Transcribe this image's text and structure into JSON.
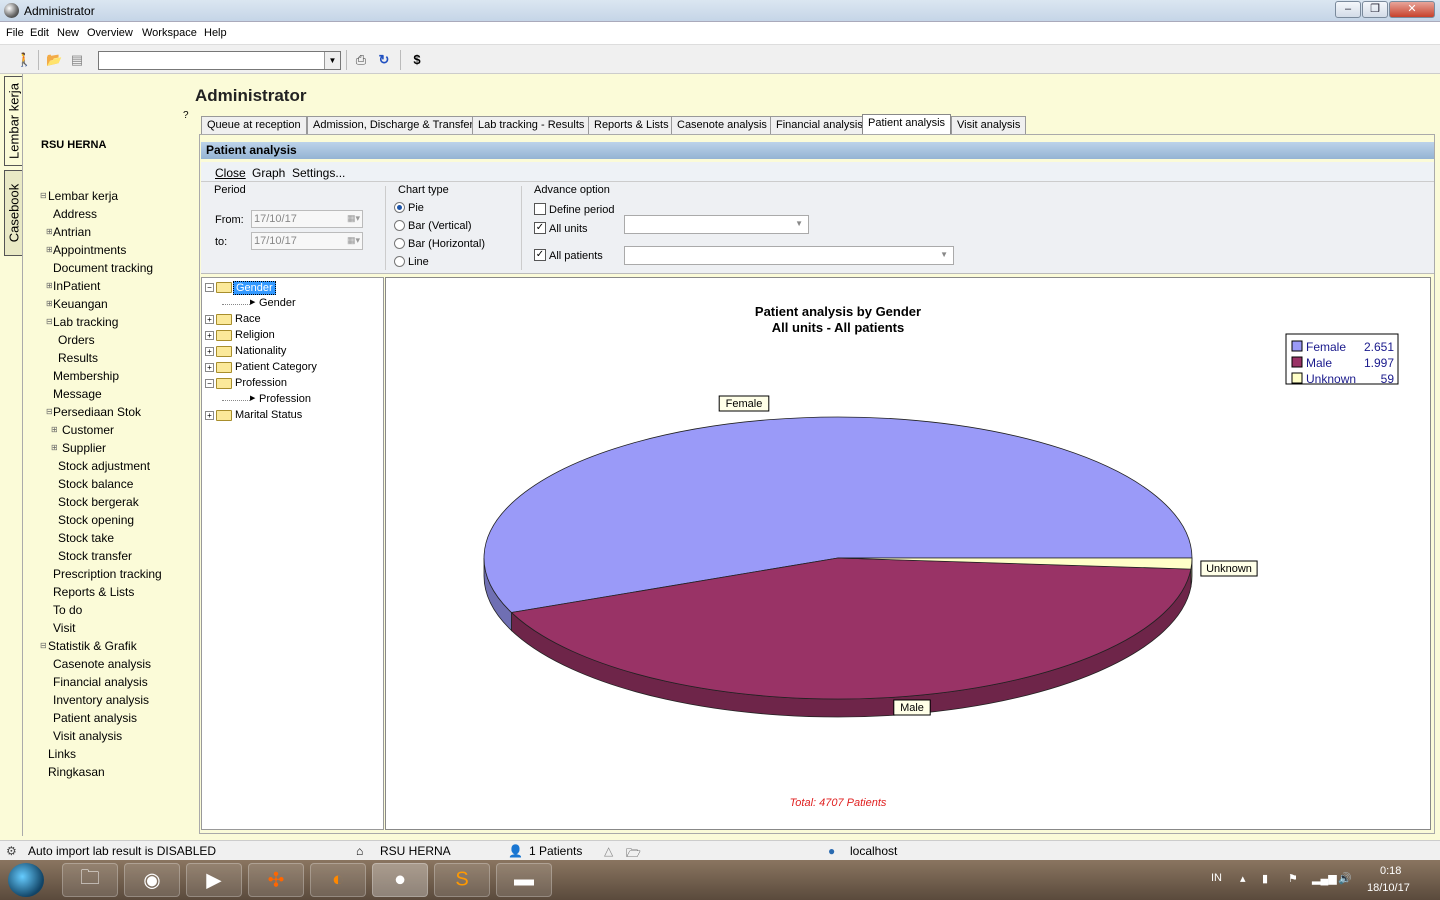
{
  "window": {
    "title": "Administrator"
  },
  "menu": [
    "File",
    "Edit",
    "New",
    "Overview",
    "Workspace",
    "Help"
  ],
  "vtabs": [
    "Lembar kerja",
    "Casebook"
  ],
  "header": {
    "title": "Administrator",
    "help": "?",
    "org": "RSU HERNA"
  },
  "nav": [
    {
      "label": "Lembar kerja",
      "ex": "⊟"
    },
    {
      "label": "Address"
    },
    {
      "label": "Antrian",
      "ex": "⊞"
    },
    {
      "label": "Appointments",
      "ex": "⊞"
    },
    {
      "label": "Document tracking"
    },
    {
      "label": "InPatient",
      "ex": "⊞"
    },
    {
      "label": "Keuangan",
      "ex": "⊞"
    },
    {
      "label": "Lab tracking",
      "ex": "⊟"
    },
    {
      "label": "Orders"
    },
    {
      "label": "Results"
    },
    {
      "label": "Membership"
    },
    {
      "label": "Message"
    },
    {
      "label": "Persediaan Stok",
      "ex": "⊟"
    },
    {
      "label": "Customer",
      "ex": "⊞"
    },
    {
      "label": "Supplier",
      "ex": "⊞"
    },
    {
      "label": "Stock adjustment"
    },
    {
      "label": "Stock balance"
    },
    {
      "label": "Stock bergerak"
    },
    {
      "label": "Stock opening"
    },
    {
      "label": "Stock take"
    },
    {
      "label": "Stock transfer"
    },
    {
      "label": "Prescription tracking"
    },
    {
      "label": "Reports & Lists"
    },
    {
      "label": "To do"
    },
    {
      "label": "Visit"
    },
    {
      "label": "Statistik & Grafik",
      "ex": "⊟"
    },
    {
      "label": "Casenote analysis"
    },
    {
      "label": "Financial analysis"
    },
    {
      "label": "Inventory analysis"
    },
    {
      "label": "Patient analysis"
    },
    {
      "label": "Visit analysis"
    },
    {
      "label": "Links"
    },
    {
      "label": "Ringkasan"
    }
  ],
  "tabs": [
    "Queue at reception",
    "Admission, Discharge & Transfer",
    "Lab tracking - Results",
    "Reports & Lists",
    "Casenote analysis",
    "Financial analysis",
    "Patient analysis",
    "Visit analysis"
  ],
  "active_tab": "Patient analysis",
  "panel": {
    "title": "Patient analysis",
    "actions": [
      "Close",
      "Graph",
      "Settings..."
    ],
    "period": {
      "label": "Period",
      "from_label": "From:",
      "to_label": "to:",
      "from": "17/10/17",
      "to": "17/10/17"
    },
    "chart_type": {
      "label": "Chart type",
      "options": [
        "Pie",
        "Bar (Vertical)",
        "Bar (Horizontal)",
        "Line"
      ],
      "selected": "Pie"
    },
    "advance": {
      "label": "Advance option",
      "define_period": "Define period",
      "all_units": "All units",
      "all_patients": "All patients"
    }
  },
  "tree": [
    {
      "label": "Gender",
      "expanded": true,
      "selected": true,
      "children": [
        "Gender"
      ]
    },
    {
      "label": "Race"
    },
    {
      "label": "Religion"
    },
    {
      "label": "Nationality"
    },
    {
      "label": "Patient Category"
    },
    {
      "label": "Profession",
      "expanded": true,
      "children": [
        "Profession"
      ]
    },
    {
      "label": "Marital Status"
    }
  ],
  "chart_data": {
    "type": "pie",
    "title": "Patient analysis by Gender",
    "subtitle": "All units - All patients",
    "slices": [
      {
        "name": "Female",
        "value": 2651,
        "display": "2.651",
        "color": "#9a9af8"
      },
      {
        "name": "Male",
        "value": 1997,
        "display": "1.997",
        "color": "#993366"
      },
      {
        "name": "Unknown",
        "value": 59,
        "display": "59",
        "color": "#ffffc8"
      }
    ],
    "legend_position": "top-right",
    "footer": "Total: 4707 Patients"
  },
  "status": {
    "left": "Auto import lab result is DISABLED",
    "org": "RSU HERNA",
    "patients": "1 Patients",
    "host": "localhost"
  },
  "tray": {
    "lang": "IN",
    "time": "0:18",
    "date": "18/10/17"
  }
}
